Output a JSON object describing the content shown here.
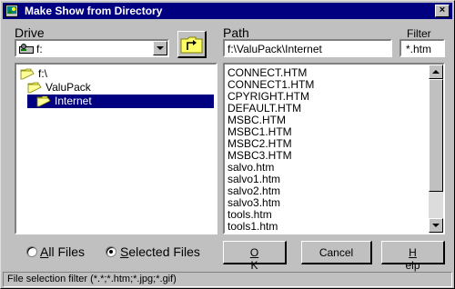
{
  "window": {
    "title": "Make Show from Directory",
    "close_glyph": "×"
  },
  "drive": {
    "label": "Drive",
    "value": "f:",
    "icon": "drive-icon"
  },
  "path": {
    "label": "Path",
    "value": "f:\\ValuPack\\Internet"
  },
  "filter": {
    "label": "Filter",
    "value": "*.htm"
  },
  "tree": [
    {
      "label": "f:\\",
      "selected": false
    },
    {
      "label": "ValuPack",
      "selected": false
    },
    {
      "label": "Internet",
      "selected": true
    }
  ],
  "files": [
    "CONNECT.HTM",
    "CONNECT1.HTM",
    "CPYRIGHT.HTM",
    "DEFAULT.HTM",
    "MSBC.HTM",
    "MSBC1.HTM",
    "MSBC2.HTM",
    "MSBC3.HTM",
    "salvo.htm",
    "salvo1.htm",
    "salvo2.htm",
    "salvo3.htm",
    "tools.htm",
    "tools1.htm"
  ],
  "radios": {
    "all_files": {
      "accel": "A",
      "rest": "ll Files",
      "checked": false
    },
    "selected_files": {
      "accel": "S",
      "rest": "elected Files",
      "checked": true
    }
  },
  "buttons": {
    "ok": {
      "accel": "O",
      "rest": "K"
    },
    "cancel": {
      "label": "Cancel"
    },
    "help": {
      "accel": "H",
      "rest": "elp"
    }
  },
  "status": "File selection filter (*.*;*.htm;*.jpg;*.gif)"
}
